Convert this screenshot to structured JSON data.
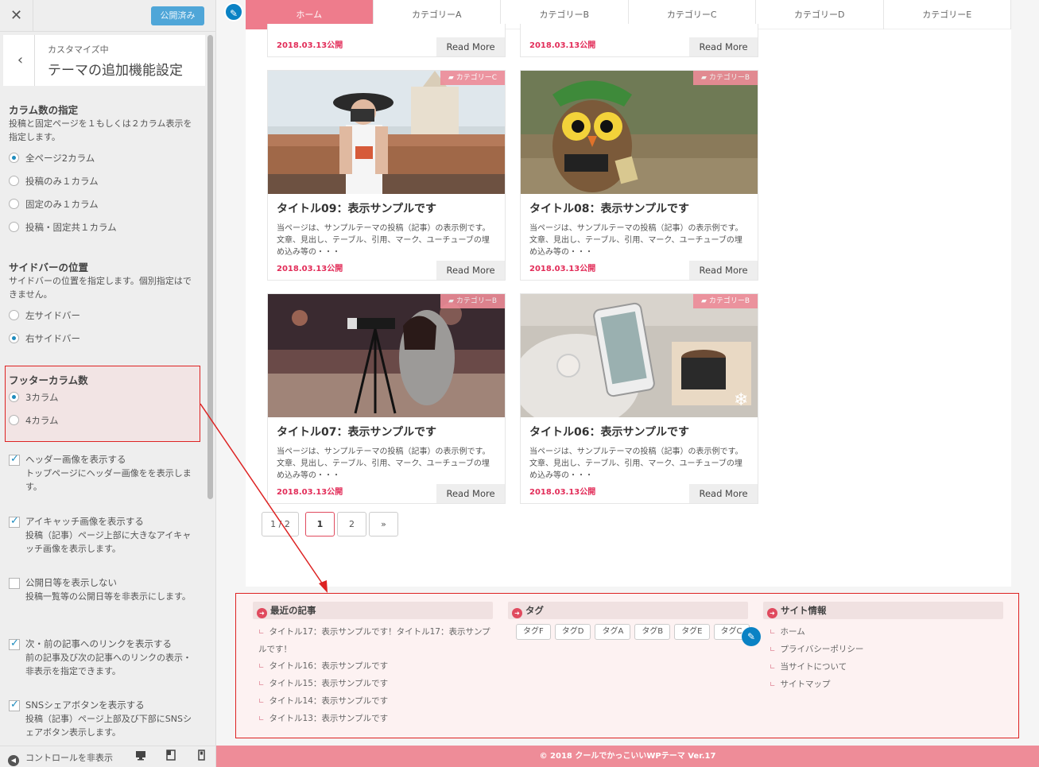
{
  "customizer": {
    "close_icon": "✕",
    "publish_label": "公開済み",
    "back_icon": "‹",
    "section_sub": "カスタマイズ中",
    "section_title": "テーマの追加機能設定",
    "columns": {
      "title": "カラム数の指定",
      "desc": "投稿と固定ページを１もしくは２カラム表示を指定します。",
      "options": [
        "全ページ2カラム",
        "投稿のみ１カラム",
        "固定のみ１カラム",
        "投稿・固定共１カラム"
      ],
      "selected": 0
    },
    "sidebar_pos": {
      "title": "サイドバーの位置",
      "desc": "サイドバーの位置を指定します。個別指定はできません。",
      "options": [
        "左サイドバー",
        "右サイドバー"
      ],
      "selected": 1
    },
    "footer_cols": {
      "title": "フッターカラム数",
      "options": [
        "3カラム",
        "4カラム"
      ],
      "selected": 0
    },
    "checks": [
      {
        "label": "ヘッダー画像を表示する",
        "desc": "トップページにヘッダー画像をを表示します。",
        "checked": true
      },
      {
        "label": "アイキャッチ画像を表示する",
        "desc": "投稿（記事）ページ上部に大きなアイキャッチ画像を表示します。",
        "checked": true
      },
      {
        "label": "公開日等を表示しない",
        "desc": "投稿一覧等の公開日等を非表示にします。",
        "checked": false
      },
      {
        "label": "次・前の記事へのリンクを表示する",
        "desc": "前の記事及び次の記事へのリンクの表示・非表示を指定できます。",
        "checked": true
      },
      {
        "label": "SNSシェアボタンを表示する",
        "desc": "投稿（記事）ページ上部及び下部にSNSシェアボタン表示します。",
        "checked": true
      }
    ],
    "hide_controls": "コントロールを非表示",
    "device_icons": [
      "desktop-icon",
      "tablet-icon",
      "mobile-icon"
    ]
  },
  "nav": {
    "items": [
      "ホーム",
      "カテゴリーA",
      "カテゴリーB",
      "カテゴリーC",
      "カテゴリーD",
      "カテゴリーE"
    ],
    "active": 0
  },
  "posts": {
    "top_dates": [
      "2018.03.13公開",
      "2018.03.13公開"
    ],
    "read_more": "Read More",
    "cards": [
      {
        "title": "タイトル09：表示サンプルです",
        "category": "カテゴリーC",
        "excerpt": "当ページは、サンプルテーマの投稿（記事）の表示例です。文章、見出し、テーブル、引用、マーク、ユーチューブの埋め込み等の・・・",
        "date": "2018.03.13公開"
      },
      {
        "title": "タイトル08：表示サンプルです",
        "category": "カテゴリーB",
        "excerpt": "当ページは、サンプルテーマの投稿（記事）の表示例です。文章、見出し、テーブル、引用、マーク、ユーチューブの埋め込み等の・・・",
        "date": "2018.03.13公開"
      },
      {
        "title": "タイトル07：表示サンプルです",
        "category": "カテゴリーB",
        "excerpt": "当ページは、サンプルテーマの投稿（記事）の表示例です。文章、見出し、テーブル、引用、マーク、ユーチューブの埋め込み等の・・・",
        "date": "2018.03.13公開"
      },
      {
        "title": "タイトル06：表示サンプルです",
        "category": "カテゴリーB",
        "excerpt": "当ページは、サンプルテーマの投稿（記事）の表示例です。文章、見出し、テーブル、引用、マーク、ユーチューブの埋め込み等の・・・",
        "date": "2018.03.13公開"
      }
    ]
  },
  "pagination": {
    "info": "1 / 2",
    "pages": [
      "1",
      "2"
    ],
    "current": "1",
    "next": "»"
  },
  "footer": {
    "recent": {
      "title": "最近の記事",
      "items": [
        "タイトル17：表示サンプルです！タイトル17：表示サンプルです！",
        "タイトル16：表示サンプルです",
        "タイトル15：表示サンプルです",
        "タイトル14：表示サンプルです",
        "タイトル13：表示サンプルです"
      ]
    },
    "tags": {
      "title": "タグ",
      "items": [
        "タグF",
        "タグD",
        "タグA",
        "タグB",
        "タグE",
        "タグC"
      ]
    },
    "site": {
      "title": "サイト情報",
      "items": [
        "ホーム",
        "プライバシーポリシー",
        "当サイトについて",
        "サイトマップ"
      ]
    }
  },
  "copyright": "© 2018 クールでかっこいいWPテーマ Ver.17",
  "colors": {
    "accent": "#ee7c8c",
    "date": "#e22d59",
    "highlight_border": "#dd2222",
    "publish": "#4fa6d8"
  }
}
